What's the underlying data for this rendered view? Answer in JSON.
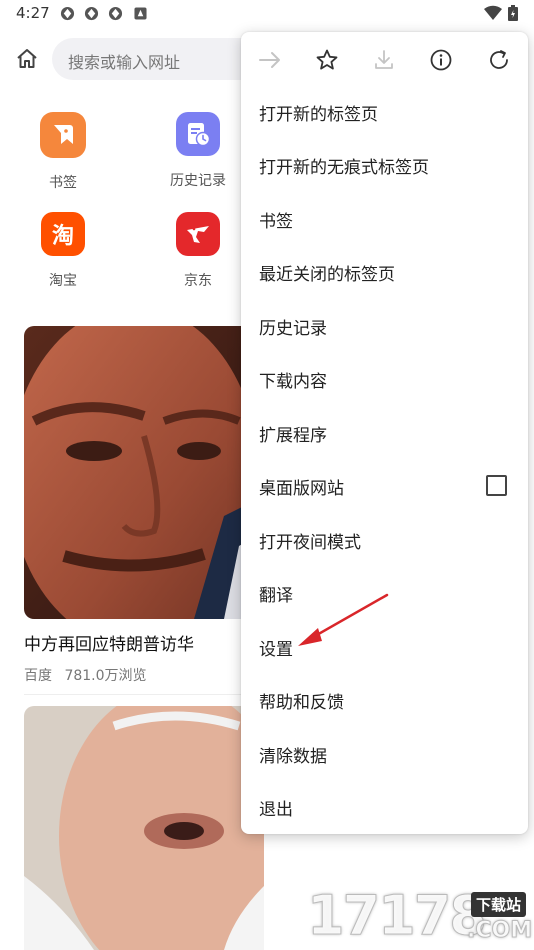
{
  "status_bar": {
    "time": "4:27"
  },
  "toolbar": {
    "home_icon": "home-icon",
    "search_placeholder": "搜索或输入网址"
  },
  "quick_links": [
    {
      "label": "书签",
      "icon": "bookmark-app-icon",
      "color": "#F5873C"
    },
    {
      "label": "历史记录",
      "icon": "history-app-icon",
      "color": "#7B7FF2"
    },
    {
      "label": "淘宝",
      "icon": "taobao-app-icon",
      "color": "#FF5000",
      "glyph": "淘"
    },
    {
      "label": "京东",
      "icon": "jd-app-icon",
      "color": "#E4282B"
    }
  ],
  "news": [
    {
      "title": "中方再回应特朗普访华",
      "source": "百度",
      "views": "781.0万浏览"
    }
  ],
  "menu": {
    "toolbar_icons": [
      "forward-icon",
      "star-icon",
      "download-icon",
      "info-icon",
      "refresh-icon"
    ],
    "items": [
      {
        "label": "打开新的标签页"
      },
      {
        "label": "打开新的无痕式标签页"
      },
      {
        "label": "书签"
      },
      {
        "label": "最近关闭的标签页"
      },
      {
        "label": "历史记录"
      },
      {
        "label": "下载内容"
      },
      {
        "label": "扩展程序"
      },
      {
        "label": "桌面版网站",
        "checkbox": false
      },
      {
        "label": "打开夜间模式"
      },
      {
        "label": "翻译"
      },
      {
        "label": "设置"
      },
      {
        "label": "帮助和反馈"
      },
      {
        "label": "清除数据"
      },
      {
        "label": "退出"
      }
    ]
  },
  "watermark": {
    "text": "17178",
    "badge": "下载站",
    "domain": ".COM"
  },
  "colors": {
    "annotation_arrow": "#D9262A"
  }
}
